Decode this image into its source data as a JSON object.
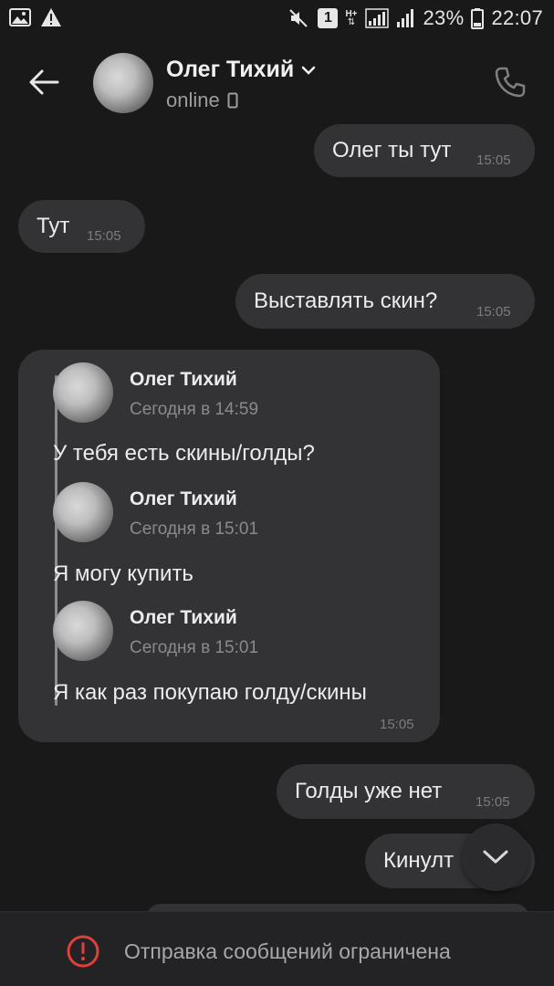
{
  "status_bar": {
    "left_icons": [
      "image-icon",
      "warning-icon"
    ],
    "right_icons": [
      "mute-icon",
      "notification-1-icon",
      "signal-h-icon",
      "signal-icon",
      "battery-icon"
    ],
    "badge": "1",
    "net_label": "H+",
    "battery": "23%",
    "time": "22:07"
  },
  "header": {
    "name": "Олег Тихий",
    "status": "online",
    "back_icon": "arrow-left-icon",
    "call_icon": "phone-icon",
    "accent": "#7f7f82"
  },
  "messages": [
    {
      "side": "out",
      "text": "Олег ты тут",
      "time": "15:05"
    },
    {
      "side": "in",
      "text": "Тут",
      "time": "15:05"
    },
    {
      "side": "out",
      "text": "Выставлять скин?",
      "time": "15:05"
    },
    {
      "side": "in",
      "time": "15:05",
      "quotes": [
        {
          "author": "Олег Тихий",
          "date": "Сегодня в 14:59",
          "text": "У тебя есть скины/голды?"
        },
        {
          "author": "Олег Тихий",
          "date": "Сегодня в 15:01",
          "text": "Я могу купить"
        },
        {
          "author": "Олег Тихий",
          "date": "Сегодня в 15:01",
          "text": "Я как раз покупаю голду/скины"
        }
      ]
    },
    {
      "side": "out",
      "text": "Голды уже нет",
      "time": "15:05"
    },
    {
      "side": "out",
      "text": "Кинулт",
      "time": ""
    }
  ],
  "footer": {
    "notice": "Отправка сообщений ограничена",
    "icon": "alert-circle-icon",
    "icon_color": "#e0403a"
  }
}
